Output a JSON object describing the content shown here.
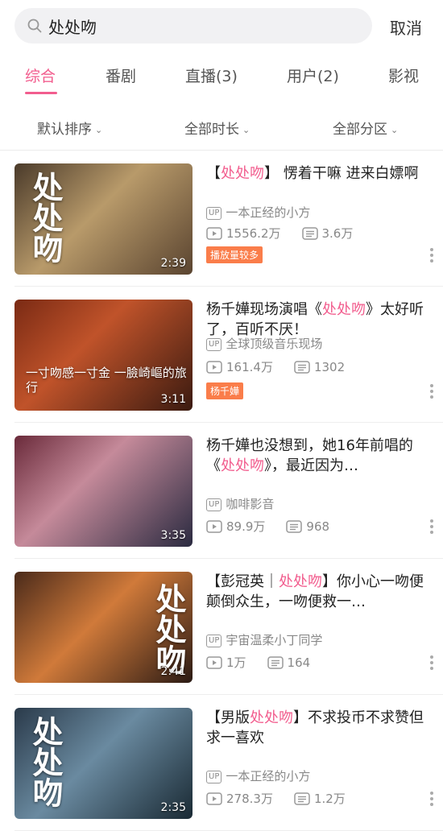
{
  "search": {
    "query": "处处吻",
    "cancel_label": "取消"
  },
  "tabs": [
    "综合",
    "番剧",
    "直播(3)",
    "用户(2)",
    "影视"
  ],
  "filters": [
    "默认排序",
    "全部时长",
    "全部分区"
  ],
  "items": [
    {
      "title_prefix": "【",
      "title_hl": "处处吻",
      "title_suffix": "】 愣着干嘛 进来白嫖啊",
      "uploader": "一本正经的小方",
      "views": "1556.2万",
      "danmaku": "3.6万",
      "duration": "2:39",
      "tag": "播放量较多",
      "thumb_text": "处处吻"
    },
    {
      "title_prefix": "杨千嬅现场演唱《",
      "title_hl": "处处吻",
      "title_suffix": "》太好听了，百听不厌！",
      "uploader": "全球顶级音乐现场",
      "views": "161.4万",
      "danmaku": "1302",
      "duration": "3:11",
      "tag": "杨千嬅",
      "thumb_text": "一寸吻感一寸金 一臉崎嶇的旅行"
    },
    {
      "title_prefix": "杨千嬅也没想到，她16年前唱的《",
      "title_hl": "处处吻",
      "title_suffix": "》，最近因为…",
      "uploader": "咖啡影音",
      "views": "89.9万",
      "danmaku": "968",
      "duration": "3:35",
      "tag": "",
      "thumb_text": ""
    },
    {
      "title_prefix": "【彭冠英｜",
      "title_hl": "处处吻",
      "title_suffix": "】你小心一吻便颠倒众生，一吻便救一…",
      "uploader": "宇宙温柔小丁同学",
      "views": "1万",
      "danmaku": "164",
      "duration": "2:41",
      "tag": "",
      "thumb_text": "处处吻"
    },
    {
      "title_prefix": "【男版",
      "title_hl": "处处吻",
      "title_suffix": "】不求投币不求赞但求一喜欢",
      "uploader": "一本正经的小方",
      "views": "278.3万",
      "danmaku": "1.2万",
      "duration": "2:35",
      "tag": "",
      "thumb_text": "处处吻"
    }
  ],
  "labels": {
    "up_badge": "UP"
  },
  "colors": {
    "accent": "#f25d8e",
    "tag_bg": "#fa7d4a",
    "text_secondary": "#888888"
  },
  "icons": [
    "search-icon",
    "play-count-icon",
    "danmaku-icon",
    "more-icon",
    "chevron-down-icon"
  ]
}
